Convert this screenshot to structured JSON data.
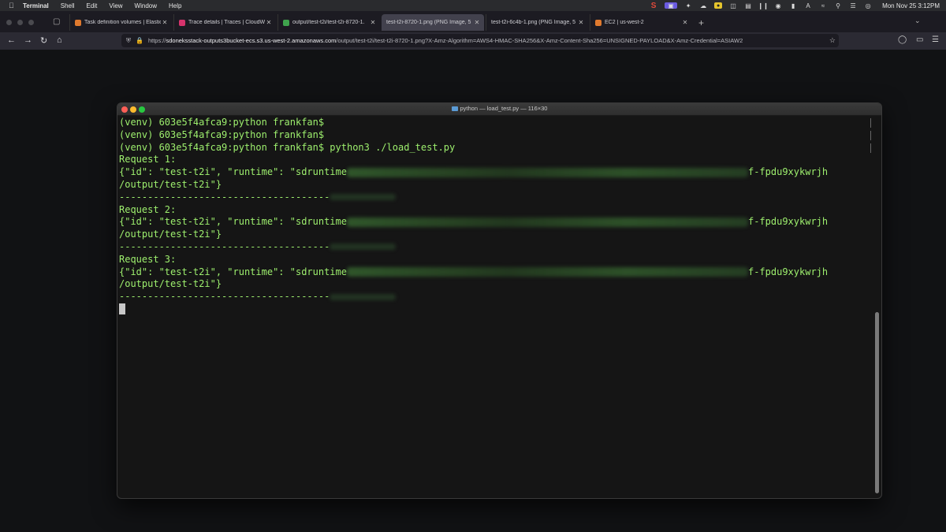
{
  "menubar": {
    "app": "Terminal",
    "items": [
      "Shell",
      "Edit",
      "View",
      "Window",
      "Help"
    ],
    "clock": "Mon Nov 25  3:12PM"
  },
  "browser": {
    "tabs": [
      {
        "title": "Task definition volumes | Elastic",
        "fav": "#e07a2e",
        "active": false
      },
      {
        "title": "Trace details | Traces | CloudWa",
        "fav": "#d6336c",
        "active": false
      },
      {
        "title": "output/test-t2i/test-t2i-8720-1.",
        "fav": "#3fa34d",
        "active": false
      },
      {
        "title": "test-t2i-8720-1.png (PNG Image, 5",
        "fav": "",
        "active": true
      },
      {
        "title": "test-t2i-6c4b-1.png (PNG Image, 5",
        "fav": "",
        "active": false
      },
      {
        "title": "EC2 | us-west-2",
        "fav": "#e07a2e",
        "active": false
      }
    ],
    "url": {
      "scheme": "https://",
      "host": "sdoneksstack-outputs3bucket-ecs.s3.us-west-2.amazonaws.com",
      "rest": "/output/test-t2i/test-t2i-8720-1.png?X-Amz-Algorithm=AWS4-HMAC-SHA256&X-Amz-Content-Sha256=UNSIGNED-PAYLOAD&X-Amz-Credential=ASIAW2"
    }
  },
  "terminal": {
    "title": "python — load_test.py — 116×30",
    "lines": {
      "l1": "(venv) 603e5f4afca9:python frankfan$",
      "l2": "(venv) 603e5f4afca9:python frankfan$",
      "l3": "(venv) 603e5f4afca9:python frankfan$ python3 ./load_test.py",
      "r1": "Request 1:",
      "r2": "Request 2:",
      "r3": "Request 3:",
      "json_start": "{\"id\": \"test-t2i\", \"runtime\": \"sdruntime",
      "json_end": "f-fpdu9xykwrjh",
      "json_tail": "/output/test-t2i\"}",
      "sep": "-------------------------------------"
    }
  }
}
